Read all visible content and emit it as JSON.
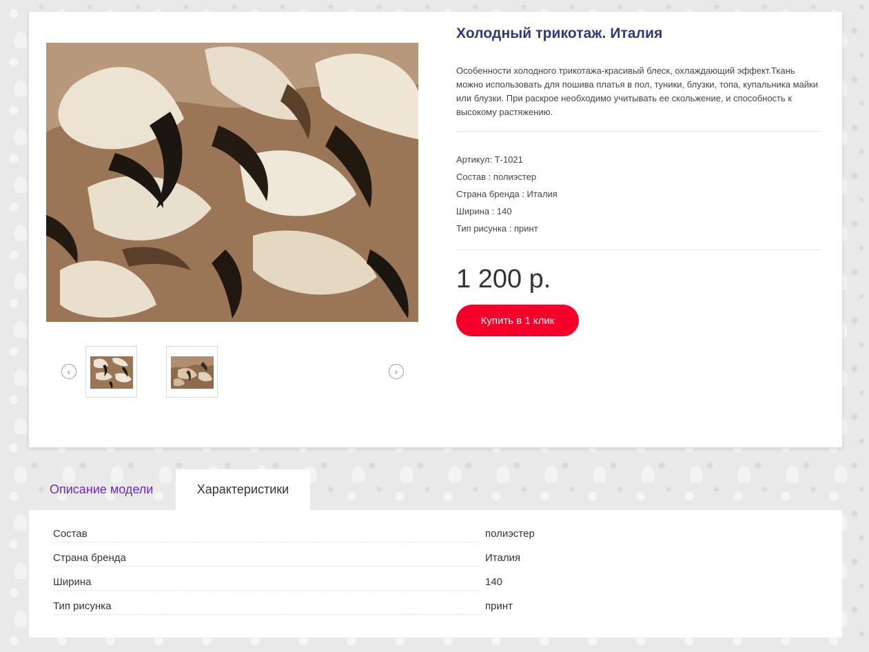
{
  "product": {
    "title": "Холодный трикотаж. Италия",
    "description": "Особенности холодного трикотажа-красивый блеск, охлаждающий эффект.Ткань можно использовать для пошива платья в пол, туники, блузки, топа, купальника майки или блузки. При раскрое необходимо учитывать ее скольжение, и способность к высокому растяжению.",
    "properties": [
      "Артикул: Т-1021",
      "Состав : полиэстер",
      "Страна бренда : Италия",
      "Ширина : 140",
      "Тип рисунка : принт"
    ],
    "price": "1 200 р.",
    "buy_button_label": "Купить в 1 клик"
  },
  "gallery": {
    "prev_icon": "chevron-left-icon",
    "next_icon": "chevron-right-icon",
    "prev_glyph": "‹",
    "next_glyph": "›"
  },
  "tabs": [
    {
      "label": "Описание модели",
      "active": false
    },
    {
      "label": "Характеристики",
      "active": true
    }
  ],
  "specs": [
    {
      "name": "Состав",
      "value": "полиэстер"
    },
    {
      "name": "Страна бренда",
      "value": "Италия"
    },
    {
      "name": "Ширина",
      "value": "140"
    },
    {
      "name": "Тип рисунка",
      "value": "принт"
    }
  ],
  "colors": {
    "title": "#2e3a7a",
    "buy_button": "#f5002a",
    "tab_link": "#6a2fb0",
    "fabric_cream": "#ece3d2",
    "fabric_brown": "#8a6446",
    "fabric_dark": "#1c1610"
  }
}
